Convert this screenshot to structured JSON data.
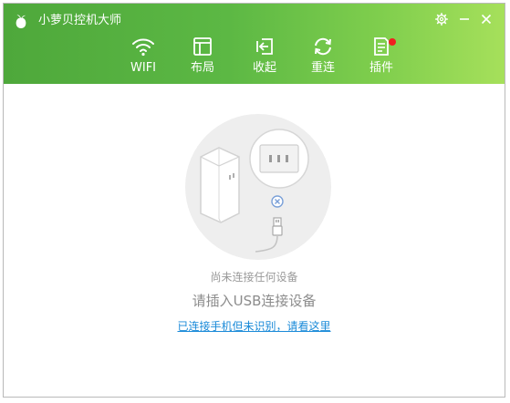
{
  "app": {
    "title": "小萝贝控机大师",
    "logo_icon": "radish-logo-icon"
  },
  "window_controls": [
    {
      "name": "settings",
      "icon": "gear-icon"
    },
    {
      "name": "minimize",
      "icon": "minimize-icon"
    },
    {
      "name": "close",
      "icon": "close-icon"
    }
  ],
  "toolbar": {
    "items": [
      {
        "label": "WIFI",
        "icon": "wifi-icon"
      },
      {
        "label": "布局",
        "icon": "layout-icon"
      },
      {
        "label": "收起",
        "icon": "collapse-icon"
      },
      {
        "label": "重连",
        "icon": "reconnect-icon"
      },
      {
        "label": "插件",
        "icon": "plugin-icon",
        "has_badge": true
      }
    ]
  },
  "main": {
    "status_small": "尚未连接任何设备",
    "status_large": "请插入USB连接设备",
    "help_link": "已连接手机但未识别，请看这里"
  },
  "colors": {
    "header_start": "#4ea83b",
    "header_end": "#a6e05b",
    "link": "#1a8ad8",
    "badge": "#f02020"
  }
}
